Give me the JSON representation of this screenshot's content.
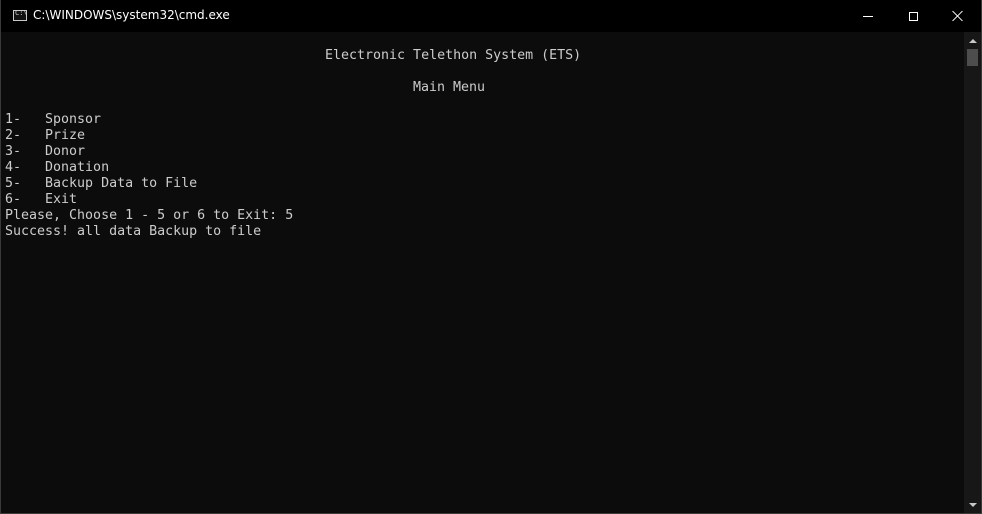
{
  "window": {
    "title": "C:\\WINDOWS\\system32\\cmd.exe",
    "icon": "cmd-icon"
  },
  "console": {
    "lines": [
      {
        "text": "Electronic Telethon System (ETS)",
        "row": 0,
        "col": 40
      },
      {
        "text": "Main Menu",
        "row": 2,
        "col": 51
      },
      {
        "text": "1-   Sponsor",
        "row": 4,
        "col": 0
      },
      {
        "text": "2-   Prize",
        "row": 5,
        "col": 0
      },
      {
        "text": "3-   Donor",
        "row": 6,
        "col": 0
      },
      {
        "text": "4-   Donation",
        "row": 7,
        "col": 0
      },
      {
        "text": "5-   Backup Data to File",
        "row": 8,
        "col": 0
      },
      {
        "text": "6-   Exit",
        "row": 9,
        "col": 0
      },
      {
        "text": "Please, Choose 1 - 5 or 6 to Exit: 5",
        "row": 10,
        "col": 0
      },
      {
        "text": "Success! all data Backup to file",
        "row": 11,
        "col": 0
      }
    ]
  },
  "colors": {
    "background": "#0c0c0c",
    "text": "#cccccc",
    "titlebar": "#000000"
  }
}
